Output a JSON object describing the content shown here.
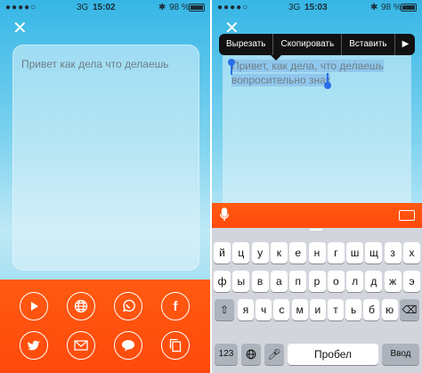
{
  "left": {
    "status": {
      "signal": "●●●●○",
      "network": "3G",
      "time": "15:02",
      "bluetooth": "✱",
      "battery": "98 %"
    },
    "note_text": "Привет как дела что делаешь",
    "share_icons": [
      "play-icon",
      "globe-icon",
      "whatsapp-icon",
      "facebook-icon",
      "twitter-icon",
      "mail-icon",
      "chat-icon",
      "copy-icon"
    ]
  },
  "right": {
    "status": {
      "signal": "●●●●○",
      "network": "3G",
      "time": "15:03",
      "bluetooth": "✱",
      "battery": "98 %"
    },
    "note_text_line1": "Привет, как дела, что делаешь",
    "note_text_line2": "вопросительно знак",
    "edit_menu": {
      "cut": "Вырезать",
      "copy": "Скопировать",
      "paste": "Вставить",
      "more": "▶"
    },
    "keyboard": {
      "row1": [
        "й",
        "ц",
        "у",
        "к",
        "е",
        "н",
        "г",
        "ш",
        "щ",
        "з",
        "х"
      ],
      "row2": [
        "ф",
        "ы",
        "в",
        "а",
        "п",
        "р",
        "о",
        "л",
        "д",
        "ж",
        "э"
      ],
      "row3": [
        "я",
        "ч",
        "с",
        "м",
        "и",
        "т",
        "ь",
        "б",
        "ю"
      ],
      "numbers_label": "123",
      "space_label": "Пробел",
      "return_label": "Ввод"
    }
  },
  "colors": {
    "accent_orange": "#ff4a0b",
    "sky_blue": "#36b6e6",
    "selection_blue": "#2a6ee8"
  }
}
